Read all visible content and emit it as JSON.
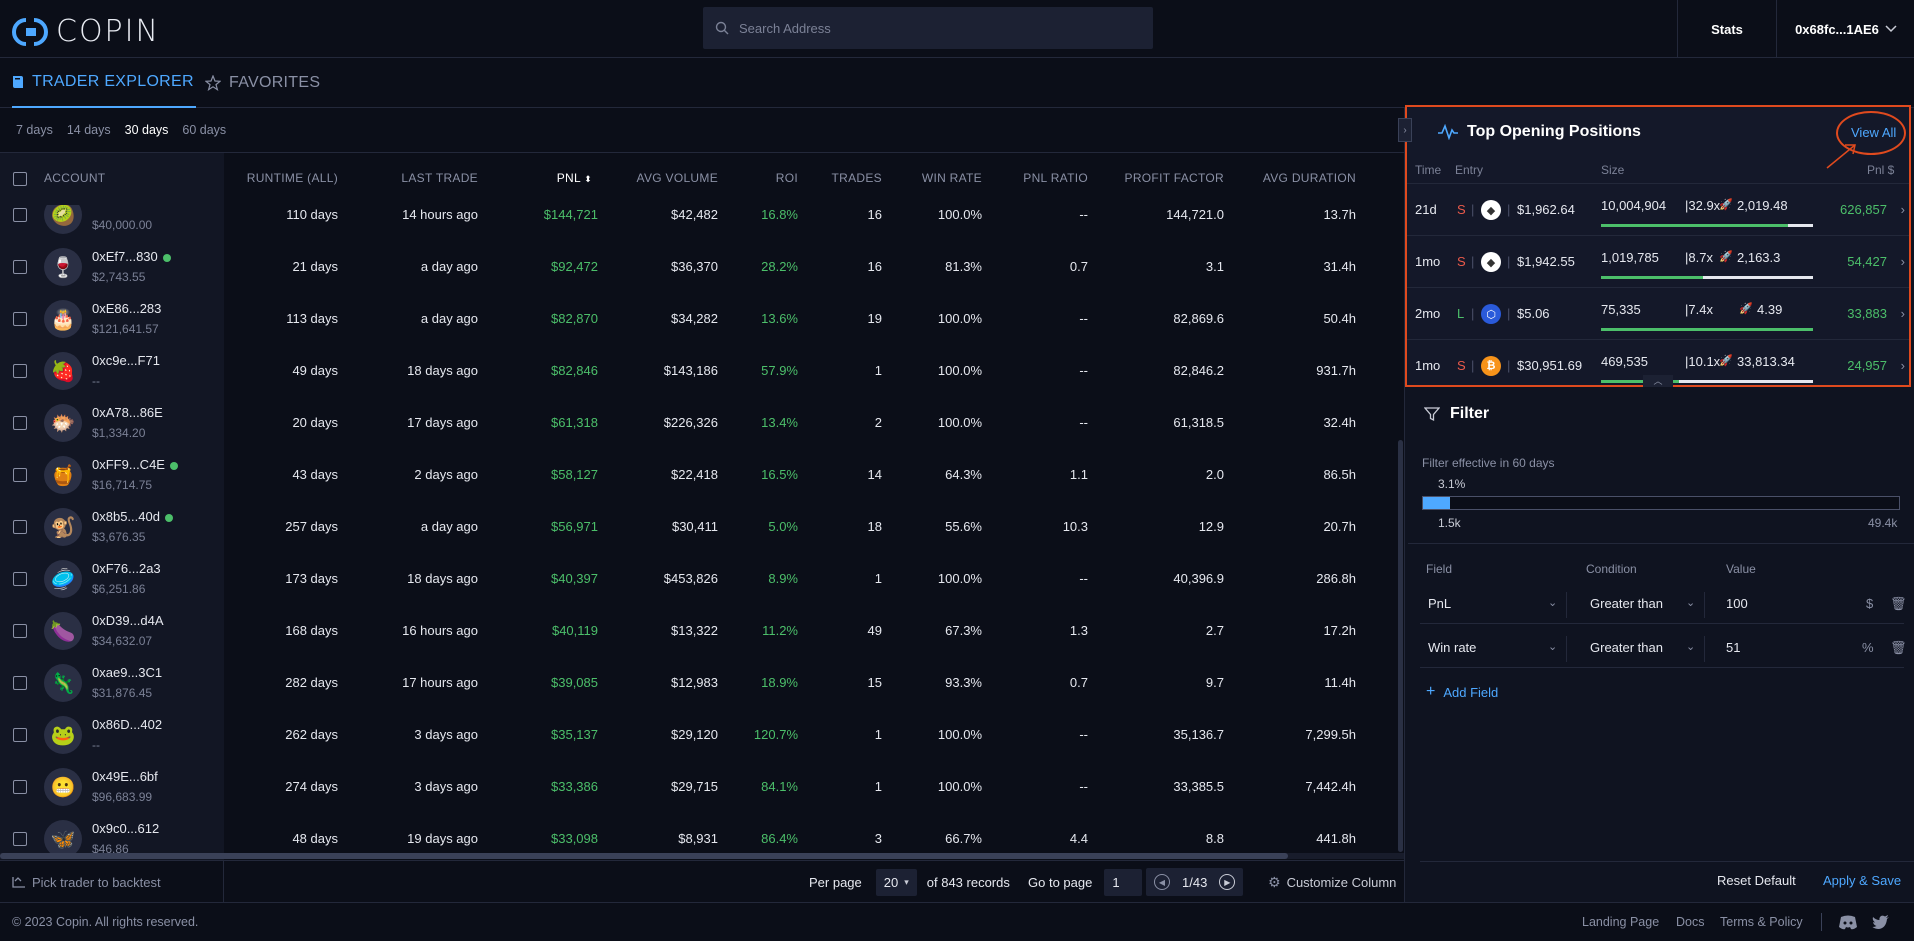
{
  "header": {
    "logo_text": "COPIN",
    "search_placeholder": "Search Address",
    "stats_label": "Stats",
    "wallet_label": "0x68fc...1AE6"
  },
  "tabs": [
    {
      "label": "TRADER EXPLORER",
      "active": true,
      "icon": "book-icon"
    },
    {
      "label": "FAVORITES",
      "active": false,
      "icon": "star-icon"
    }
  ],
  "periods": [
    {
      "label": "7 days",
      "active": false
    },
    {
      "label": "14 days",
      "active": false
    },
    {
      "label": "30 days",
      "active": true
    },
    {
      "label": "60 days",
      "active": false
    }
  ],
  "table": {
    "columns": [
      "ACCOUNT",
      "RUNTIME (ALL)",
      "LAST TRADE",
      "PNL",
      "AVG VOLUME",
      "ROI",
      "TRADES",
      "WIN RATE",
      "PNL RATIO",
      "PROFIT FACTOR",
      "AVG DURATION"
    ],
    "rows": [
      {
        "account": "",
        "balance": "$40,000.00",
        "avatar": "🥝",
        "online": false,
        "runtime": "110 days",
        "last_trade": "14 hours ago",
        "pnl": "$144,721",
        "avg_volume": "$42,482",
        "roi": "16.8%",
        "trades": "16",
        "win_rate": "100.0%",
        "pnl_ratio": "--",
        "profit_factor": "144,721.0",
        "avg_duration": "13.7h"
      },
      {
        "account": "0xEf7...830",
        "balance": "$2,743.55",
        "avatar": "🍷",
        "online": true,
        "runtime": "21 days",
        "last_trade": "a day ago",
        "pnl": "$92,472",
        "avg_volume": "$36,370",
        "roi": "28.2%",
        "trades": "16",
        "win_rate": "81.3%",
        "pnl_ratio": "0.7",
        "profit_factor": "3.1",
        "avg_duration": "31.4h"
      },
      {
        "account": "0xE86...283",
        "balance": "$121,641.57",
        "avatar": "🎂",
        "online": false,
        "runtime": "113 days",
        "last_trade": "a day ago",
        "pnl": "$82,870",
        "avg_volume": "$34,282",
        "roi": "13.6%",
        "trades": "19",
        "win_rate": "100.0%",
        "pnl_ratio": "--",
        "profit_factor": "82,869.6",
        "avg_duration": "50.4h"
      },
      {
        "account": "0xc9e...F71",
        "balance": "--",
        "avatar": "🍓",
        "online": false,
        "runtime": "49 days",
        "last_trade": "18 days ago",
        "pnl": "$82,846",
        "avg_volume": "$143,186",
        "roi": "57.9%",
        "trades": "1",
        "win_rate": "100.0%",
        "pnl_ratio": "--",
        "profit_factor": "82,846.2",
        "avg_duration": "931.7h"
      },
      {
        "account": "0xA78...86E",
        "balance": "$1,334.20",
        "avatar": "🐡",
        "online": false,
        "runtime": "20 days",
        "last_trade": "17 days ago",
        "pnl": "$61,318",
        "avg_volume": "$226,326",
        "roi": "13.4%",
        "trades": "2",
        "win_rate": "100.0%",
        "pnl_ratio": "--",
        "profit_factor": "61,318.5",
        "avg_duration": "32.4h"
      },
      {
        "account": "0xFF9...C4E",
        "balance": "$16,714.75",
        "avatar": "🍯",
        "online": true,
        "runtime": "43 days",
        "last_trade": "2 days ago",
        "pnl": "$58,127",
        "avg_volume": "$22,418",
        "roi": "16.5%",
        "trades": "14",
        "win_rate": "64.3%",
        "pnl_ratio": "1.1",
        "profit_factor": "2.0",
        "avg_duration": "86.5h"
      },
      {
        "account": "0x8b5...40d",
        "balance": "$3,676.35",
        "avatar": "🐒",
        "online": true,
        "runtime": "257 days",
        "last_trade": "a day ago",
        "pnl": "$56,971",
        "avg_volume": "$30,411",
        "roi": "5.0%",
        "trades": "18",
        "win_rate": "55.6%",
        "pnl_ratio": "10.3",
        "profit_factor": "12.9",
        "avg_duration": "20.7h"
      },
      {
        "account": "0xF76...2a3",
        "balance": "$6,251.86",
        "avatar": "🥏",
        "online": false,
        "runtime": "173 days",
        "last_trade": "18 days ago",
        "pnl": "$40,397",
        "avg_volume": "$453,826",
        "roi": "8.9%",
        "trades": "1",
        "win_rate": "100.0%",
        "pnl_ratio": "--",
        "profit_factor": "40,396.9",
        "avg_duration": "286.8h"
      },
      {
        "account": "0xD39...d4A",
        "balance": "$34,632.07",
        "avatar": "🍆",
        "online": false,
        "runtime": "168 days",
        "last_trade": "16 hours ago",
        "pnl": "$40,119",
        "avg_volume": "$13,322",
        "roi": "11.2%",
        "trades": "49",
        "win_rate": "67.3%",
        "pnl_ratio": "1.3",
        "profit_factor": "2.7",
        "avg_duration": "17.2h"
      },
      {
        "account": "0xae9...3C1",
        "balance": "$31,876.45",
        "avatar": "🦎",
        "online": false,
        "runtime": "282 days",
        "last_trade": "17 hours ago",
        "pnl": "$39,085",
        "avg_volume": "$12,983",
        "roi": "18.9%",
        "trades": "15",
        "win_rate": "93.3%",
        "pnl_ratio": "0.7",
        "profit_factor": "9.7",
        "avg_duration": "11.4h"
      },
      {
        "account": "0x86D...402",
        "balance": "--",
        "avatar": "🐸",
        "online": false,
        "runtime": "262 days",
        "last_trade": "3 days ago",
        "pnl": "$35,137",
        "avg_volume": "$29,120",
        "roi": "120.7%",
        "trades": "1",
        "win_rate": "100.0%",
        "pnl_ratio": "--",
        "profit_factor": "35,136.7",
        "avg_duration": "7,299.5h"
      },
      {
        "account": "0x49E...6bf",
        "balance": "$96,683.99",
        "avatar": "😬",
        "online": false,
        "runtime": "274 days",
        "last_trade": "3 days ago",
        "pnl": "$33,386",
        "avg_volume": "$29,715",
        "roi": "84.1%",
        "trades": "1",
        "win_rate": "100.0%",
        "pnl_ratio": "--",
        "profit_factor": "33,385.5",
        "avg_duration": "7,442.4h"
      },
      {
        "account": "0x9c0...612",
        "balance": "$46.86",
        "avatar": "🦋",
        "online": false,
        "runtime": "48 days",
        "last_trade": "19 days ago",
        "pnl": "$33,098",
        "avg_volume": "$8,931",
        "roi": "86.4%",
        "trades": "3",
        "win_rate": "66.7%",
        "pnl_ratio": "4.4",
        "profit_factor": "8.8",
        "avg_duration": "441.8h"
      }
    ]
  },
  "table_footer": {
    "backtest_label": "Pick trader to backtest",
    "per_page_label": "Per page",
    "per_page_value": "20",
    "records_label": "of 843 records",
    "goto_label": "Go to page",
    "goto_value": "1",
    "page_indicator": "1/43",
    "customize_label": "Customize Column"
  },
  "top_positions": {
    "title": "Top Opening Positions",
    "view_all": "View All",
    "headers": {
      "time": "Time",
      "entry": "Entry",
      "size": "Size",
      "pnl": "Pnl $"
    },
    "rows": [
      {
        "time": "21d",
        "side": "S",
        "coin": "eth-icon",
        "entry": "$1,962.64",
        "size": "10,004,904",
        "leverage": "32.9x",
        "liq": "2,019.48",
        "pnl": "626,857",
        "progress": 0.88,
        "size_share": 1.0
      },
      {
        "time": "1mo",
        "side": "S",
        "coin": "eth-icon",
        "entry": "$1,942.55",
        "size": "1,019,785",
        "leverage": "8.7x",
        "liq": "2,163.3",
        "pnl": "54,427",
        "progress": 0.48,
        "size_share": 0.48
      },
      {
        "time": "2mo",
        "side": "L",
        "coin": "link-icon",
        "entry": "$5.06",
        "size": "75,335",
        "leverage": "7.4x",
        "liq": "4.39",
        "pnl": "33,883",
        "progress": 1.0,
        "size_share": 1.0
      },
      {
        "time": "1mo",
        "side": "S",
        "coin": "btc-icon",
        "entry": "$30,951.69",
        "size": "469,535",
        "leverage": "10.1x",
        "liq": "33,813.34",
        "pnl": "24,957",
        "progress": 0.37,
        "size_share": 0.37
      }
    ]
  },
  "filter": {
    "title": "Filter",
    "effective": "Filter effective in 60 days",
    "pct": "3.1%",
    "pct_value": 0.031,
    "min": "1.5k",
    "max": "49.4k",
    "headers": {
      "field": "Field",
      "condition": "Condition",
      "value": "Value"
    },
    "rows": [
      {
        "field": "PnL",
        "condition": "Greater than",
        "value": "100",
        "unit": "$"
      },
      {
        "field": "Win rate",
        "condition": "Greater than",
        "value": "51",
        "unit": "%"
      }
    ],
    "add_field": "Add Field",
    "reset": "Reset Default",
    "apply": "Apply & Save"
  },
  "footer": {
    "copyright": "© 2023 Copin. All rights reserved.",
    "links": [
      "Landing Page",
      "Docs",
      "Terms & Policy"
    ]
  },
  "colors": {
    "accent": "#4ea8ff",
    "positive": "#4cbf6a",
    "short": "#e8594a",
    "highlight": "#e04a1e"
  }
}
